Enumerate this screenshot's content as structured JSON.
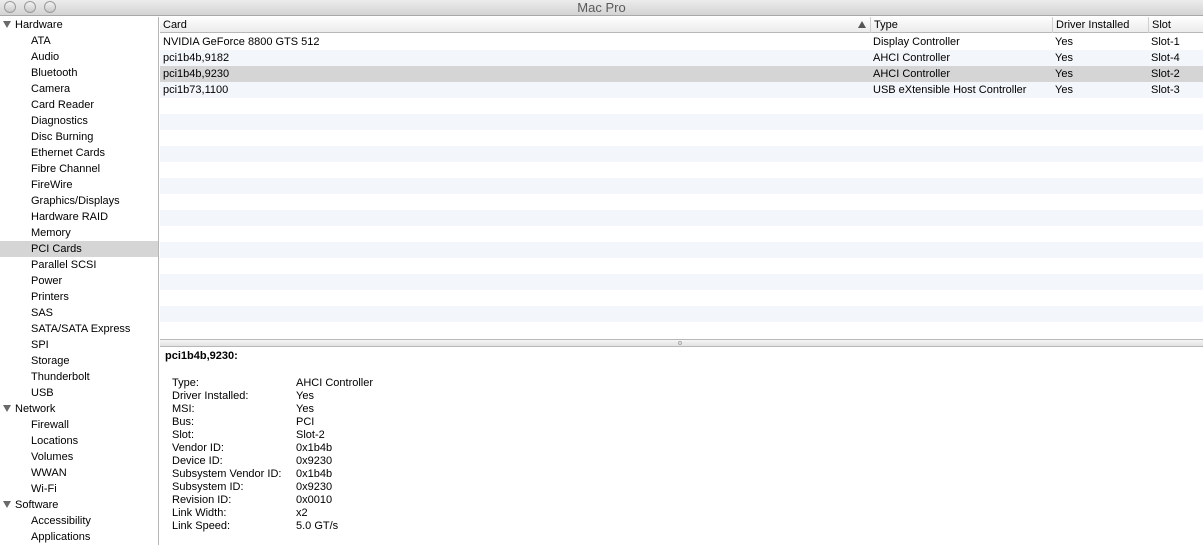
{
  "window": {
    "title": "Mac Pro"
  },
  "sidebar": {
    "groups": [
      {
        "label": "Hardware",
        "items": [
          "ATA",
          "Audio",
          "Bluetooth",
          "Camera",
          "Card Reader",
          "Diagnostics",
          "Disc Burning",
          "Ethernet Cards",
          "Fibre Channel",
          "FireWire",
          "Graphics/Displays",
          "Hardware RAID",
          "Memory",
          "PCI Cards",
          "Parallel SCSI",
          "Power",
          "Printers",
          "SAS",
          "SATA/SATA Express",
          "SPI",
          "Storage",
          "Thunderbolt",
          "USB"
        ]
      },
      {
        "label": "Network",
        "items": [
          "Firewall",
          "Locations",
          "Volumes",
          "WWAN",
          "Wi-Fi"
        ]
      },
      {
        "label": "Software",
        "items": [
          "Accessibility",
          "Applications"
        ]
      }
    ],
    "selected": "PCI Cards"
  },
  "table": {
    "columns": {
      "card": "Card",
      "type": "Type",
      "driver": "Driver Installed",
      "slot": "Slot"
    },
    "rows": [
      {
        "card": "NVIDIA GeForce 8800 GTS 512",
        "type": "Display Controller",
        "driver": "Yes",
        "slot": "Slot-1"
      },
      {
        "card": "pci1b4b,9182",
        "type": "AHCI Controller",
        "driver": "Yes",
        "slot": "Slot-4"
      },
      {
        "card": "pci1b4b,9230",
        "type": "AHCI Controller",
        "driver": "Yes",
        "slot": "Slot-2"
      },
      {
        "card": "pci1b73,1100",
        "type": "USB eXtensible Host Controller",
        "driver": "Yes",
        "slot": "Slot-3"
      }
    ],
    "selected_row": 2
  },
  "detail": {
    "title": "pci1b4b,9230:",
    "fields": [
      {
        "key": "Type:",
        "value": "AHCI Controller"
      },
      {
        "key": "Driver Installed:",
        "value": "Yes"
      },
      {
        "key": "MSI:",
        "value": "Yes"
      },
      {
        "key": "Bus:",
        "value": "PCI"
      },
      {
        "key": "Slot:",
        "value": "Slot-2"
      },
      {
        "key": "Vendor ID:",
        "value": "0x1b4b"
      },
      {
        "key": "Device ID:",
        "value": "0x9230"
      },
      {
        "key": "Subsystem Vendor ID:",
        "value": "0x1b4b"
      },
      {
        "key": "Subsystem ID:",
        "value": "0x9230"
      },
      {
        "key": "Revision ID:",
        "value": "0x0010"
      },
      {
        "key": "Link Width:",
        "value": "x2"
      },
      {
        "key": "Link Speed:",
        "value": "5.0 GT/s"
      }
    ]
  },
  "colors": {
    "selection": "#d5d5d5",
    "alt_row": "#f3f6fa"
  }
}
